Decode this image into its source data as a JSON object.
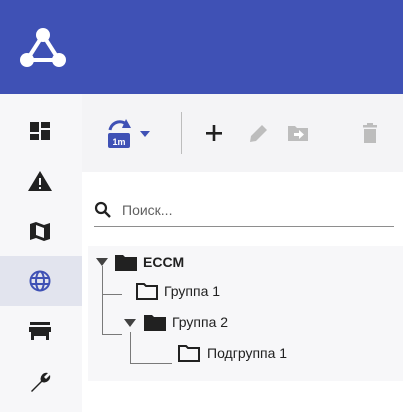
{
  "header": {
    "logo_icon": "network-nodes-icon",
    "background_color": "#3f51b5"
  },
  "sidebar": {
    "items": [
      {
        "icon": "dashboard-icon",
        "active": false
      },
      {
        "icon": "warning-icon",
        "active": false
      },
      {
        "icon": "map-icon",
        "active": false
      },
      {
        "icon": "globe-icon",
        "active": true
      },
      {
        "icon": "storefront-icon",
        "active": false
      },
      {
        "icon": "wrench-icon",
        "active": false
      }
    ]
  },
  "toolbar": {
    "sync_badge": "1m",
    "sync_icon": "sync-interval-icon",
    "dropdown_icon": "caret-down-icon",
    "actions": [
      "add-icon",
      "edit-icon",
      "move-to-folder-icon",
      "delete-icon"
    ],
    "accent_color": "#3f51b5"
  },
  "search": {
    "placeholder": "Поиск..."
  },
  "tree": {
    "nodes": [
      {
        "label": "ECCM",
        "bold": true,
        "expanded": true,
        "icon": "folder-filled-icon"
      },
      {
        "label": "Группа 1",
        "bold": false,
        "icon": "folder-outline-icon"
      },
      {
        "label": "Группа 2",
        "bold": false,
        "expanded": true,
        "icon": "folder-filled-icon"
      },
      {
        "label": "Подгруппа 1",
        "bold": false,
        "icon": "folder-outline-icon"
      }
    ]
  }
}
